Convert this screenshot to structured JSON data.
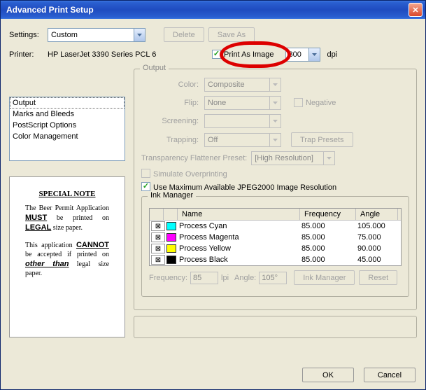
{
  "window": {
    "title": "Advanced Print Setup"
  },
  "settings": {
    "label": "Settings:",
    "value": "Custom",
    "delete": "Delete",
    "saveAs": "Save As"
  },
  "printer": {
    "label": "Printer:",
    "name": "HP LaserJet 3390 Series PCL 6",
    "printAsImage": "Print As Image",
    "dpiValue": "300",
    "dpiLabel": "dpi"
  },
  "nav": {
    "items": [
      "Output",
      "Marks and Bleeds",
      "PostScript Options",
      "Color Management"
    ]
  },
  "preview": {
    "heading": "SPECIAL NOTE"
  },
  "output": {
    "legend": "Output",
    "colorLabel": "Color:",
    "colorValue": "Composite",
    "flipLabel": "Flip:",
    "flipValue": "None",
    "negative": "Negative",
    "screeningLabel": "Screening:",
    "trappingLabel": "Trapping:",
    "trappingValue": "Off",
    "trapPresets": "Trap Presets",
    "flattenerLabel": "Transparency Flattener Preset:",
    "flattenerValue": "[High Resolution]",
    "simulate": "Simulate Overprinting",
    "jpeg2000": "Use Maximum Available JPEG2000 Image Resolution"
  },
  "ink": {
    "legend": "Ink Manager",
    "headers": {
      "name": "Name",
      "freq": "Frequency",
      "angle": "Angle"
    },
    "rows": [
      {
        "swatch": "#00ffff",
        "name": "Process Cyan",
        "freq": "85.000",
        "angle": "105.000"
      },
      {
        "swatch": "#ff00ff",
        "name": "Process Magenta",
        "freq": "85.000",
        "angle": "75.000"
      },
      {
        "swatch": "#ffff00",
        "name": "Process Yellow",
        "freq": "85.000",
        "angle": "90.000"
      },
      {
        "swatch": "#000000",
        "name": "Process Black",
        "freq": "85.000",
        "angle": "45.000"
      }
    ],
    "freqLabel": "Frequency:",
    "freqValue": "85",
    "lpi": "lpi",
    "angleLabel": "Angle:",
    "angleValue": "105°",
    "inkManagerBtn": "Ink Manager",
    "resetBtn": "Reset"
  },
  "footer": {
    "ok": "OK",
    "cancel": "Cancel"
  }
}
